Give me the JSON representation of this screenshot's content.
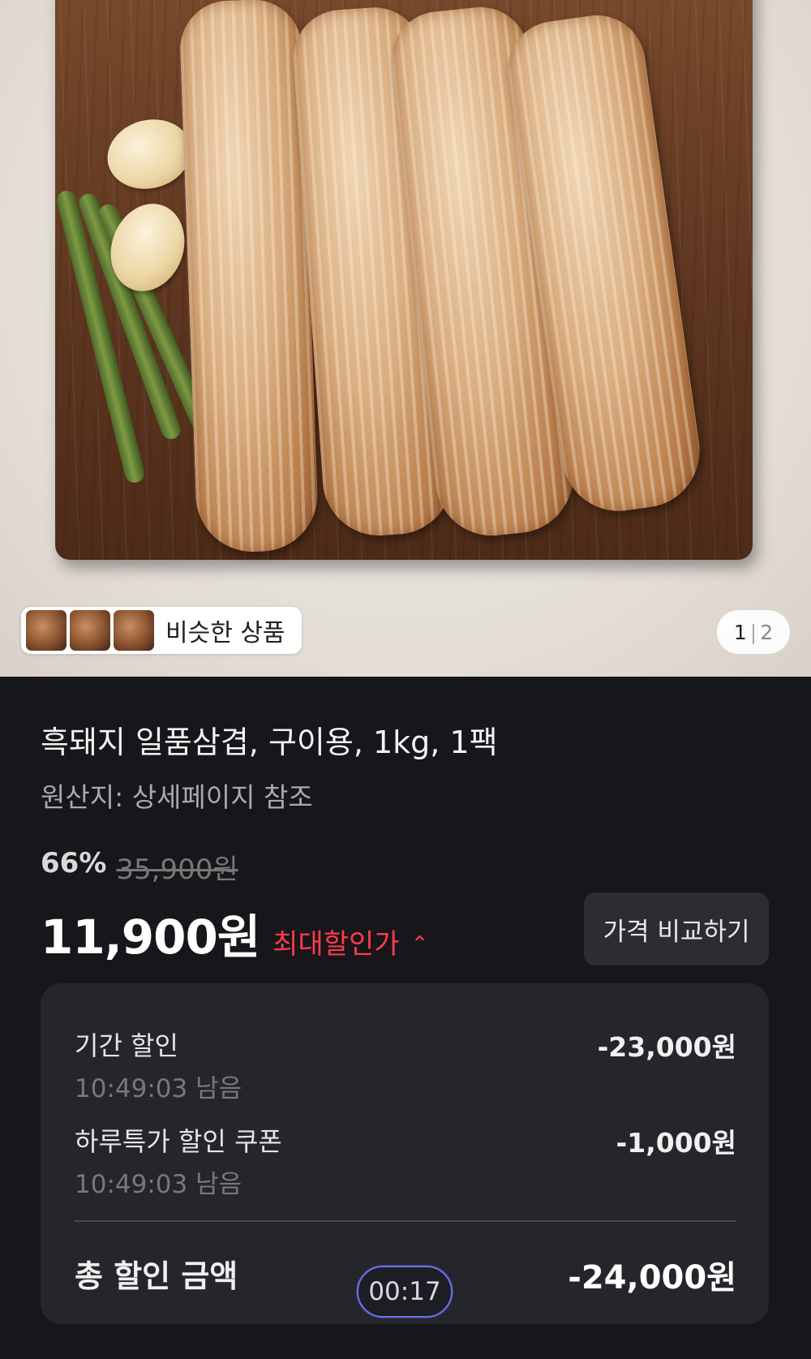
{
  "hero": {
    "similar_label": "비슷한 상품",
    "page_current": "1",
    "page_total": "2"
  },
  "product": {
    "title": "흑돼지 일품삼겹, 구이용, 1kg, 1팩",
    "origin": "원산지: 상세페이지 참조"
  },
  "pricing": {
    "discount_rate": "66%",
    "original_price": "35,900원",
    "price": "11,900원",
    "max_discount_label": "최대할인가",
    "compare_button": "가격 비교하기"
  },
  "discounts": {
    "items": [
      {
        "label": "기간 할인",
        "time_left": "10:49:03 남음",
        "amount": "-23,000원"
      },
      {
        "label": "하루특가 할인 쿠폰",
        "time_left": "10:49:03 남음",
        "amount": "-1,000원"
      }
    ],
    "total_label": "총 할인 금액",
    "total_amount": "-24,000원"
  },
  "timer": "00:17",
  "colors": {
    "background": "#16161b",
    "panel": "#25262b",
    "accent_red": "#ff3b4a",
    "timer_border": "#6a6ff0"
  }
}
